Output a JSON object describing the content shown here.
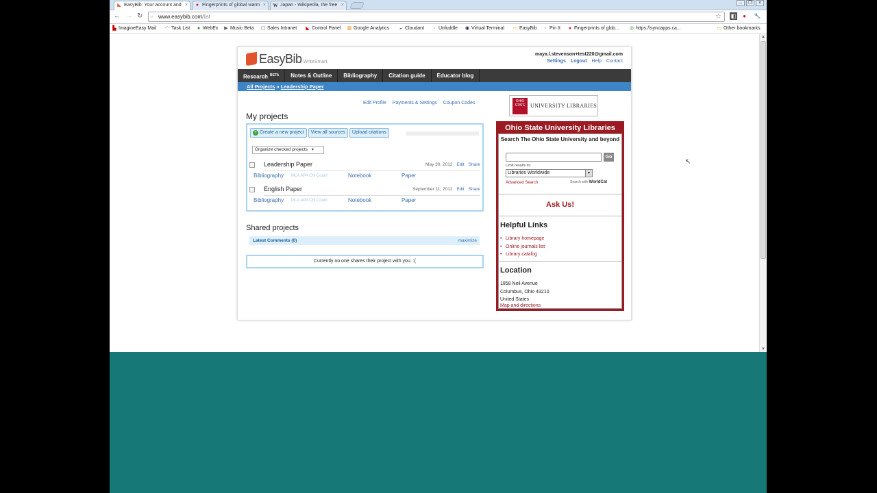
{
  "browser": {
    "tabs": [
      {
        "title": "EasyBib: Your account and",
        "favicon": "easybib-icon",
        "active": true
      },
      {
        "title": "Fingerprints of global warm",
        "favicon": "pinterest-icon",
        "active": false
      },
      {
        "title": "Japan - Wikipedia, the free",
        "favicon": "wikipedia-icon",
        "active": false
      }
    ],
    "url_host": "www.easybib.com",
    "url_path": "/list",
    "bookmarks": [
      "ImagineEasy Mail",
      "Task List",
      "WebEx",
      "Music Beta",
      "Sales Intranet",
      "Control Panel",
      "Google Analytics",
      "Cloudant",
      "Unfuddle",
      "Virtual Terminal",
      "EasyBib",
      "Pin It",
      "Fingerprints of glob...",
      "https://syncapps.ca...",
      "Other bookmarks"
    ]
  },
  "header": {
    "brand": "EasyBib",
    "tagline": "WriteSmart.",
    "email": "maya.l.stevenson+test220@gmail.com",
    "links": [
      "Settings",
      "Logout",
      "Help",
      "Contact"
    ]
  },
  "nav": {
    "items": [
      "Research",
      "Notes & Outline",
      "Bibliography",
      "Citation guide",
      "Educator blog"
    ],
    "beta": "BETA"
  },
  "breadcrumb": {
    "all": "All Projects",
    "sep": " » ",
    "current": "Leadership Paper"
  },
  "profile_links": [
    "Edit Profile",
    "Payments & Settings",
    "Coupon Codes"
  ],
  "my_projects": {
    "title": "My projects",
    "buttons": [
      "Create a new project",
      "View all sources",
      "Upload citations"
    ],
    "organize": "Organize checked projects",
    "projects": [
      {
        "name": "Leadership Paper",
        "date": "May 30, 2012",
        "edit": "Edit",
        "share": "Share",
        "bibliography": "Bibliography",
        "formats": "MLA  APA  Chi   Count",
        "notebook": "Notebook",
        "paper": "Paper"
      },
      {
        "name": "English Paper",
        "date": "September 11, 2012",
        "edit": "Edit",
        "share": "Share",
        "bibliography": "Bibliography",
        "formats": "MLA  APA  Chi   Count",
        "notebook": "Notebook",
        "paper": "Paper"
      }
    ]
  },
  "shared": {
    "title": "Shared projects",
    "comments": "Latest Comments (0)",
    "maximize": "maximize",
    "empty": "Currently no one shares their project with you. :("
  },
  "osu": {
    "logo_seal": "OHIO STATE",
    "logo_text": "UNIVERSITY LIBRARIES",
    "header": "Ohio State University Libraries",
    "search_title": "Search The Ohio State University and beyond",
    "go": "Go",
    "limit_label": "Limit results to:",
    "limit_value": "Libraries Worldwide",
    "advanced": "Advanced Search",
    "search_with": "Search with",
    "worldcat": "WorldCat",
    "ask": "Ask Us!",
    "helpful_title": "Helpful Links",
    "helpful_links": [
      "Library homepage",
      "Online journals list",
      "Library catalog"
    ],
    "location_title": "Location",
    "address": [
      "1858 Neil Avenue",
      "Columbus, Ohio 43210",
      "United States"
    ],
    "map": "Map and directions"
  },
  "colors": {
    "nav_bg": "#3b3b3b",
    "breadcrumb_bg": "#3d85c6",
    "osu_red": "#9c1a22",
    "teal": "#177878",
    "easybib_orange": "#e2542c"
  }
}
